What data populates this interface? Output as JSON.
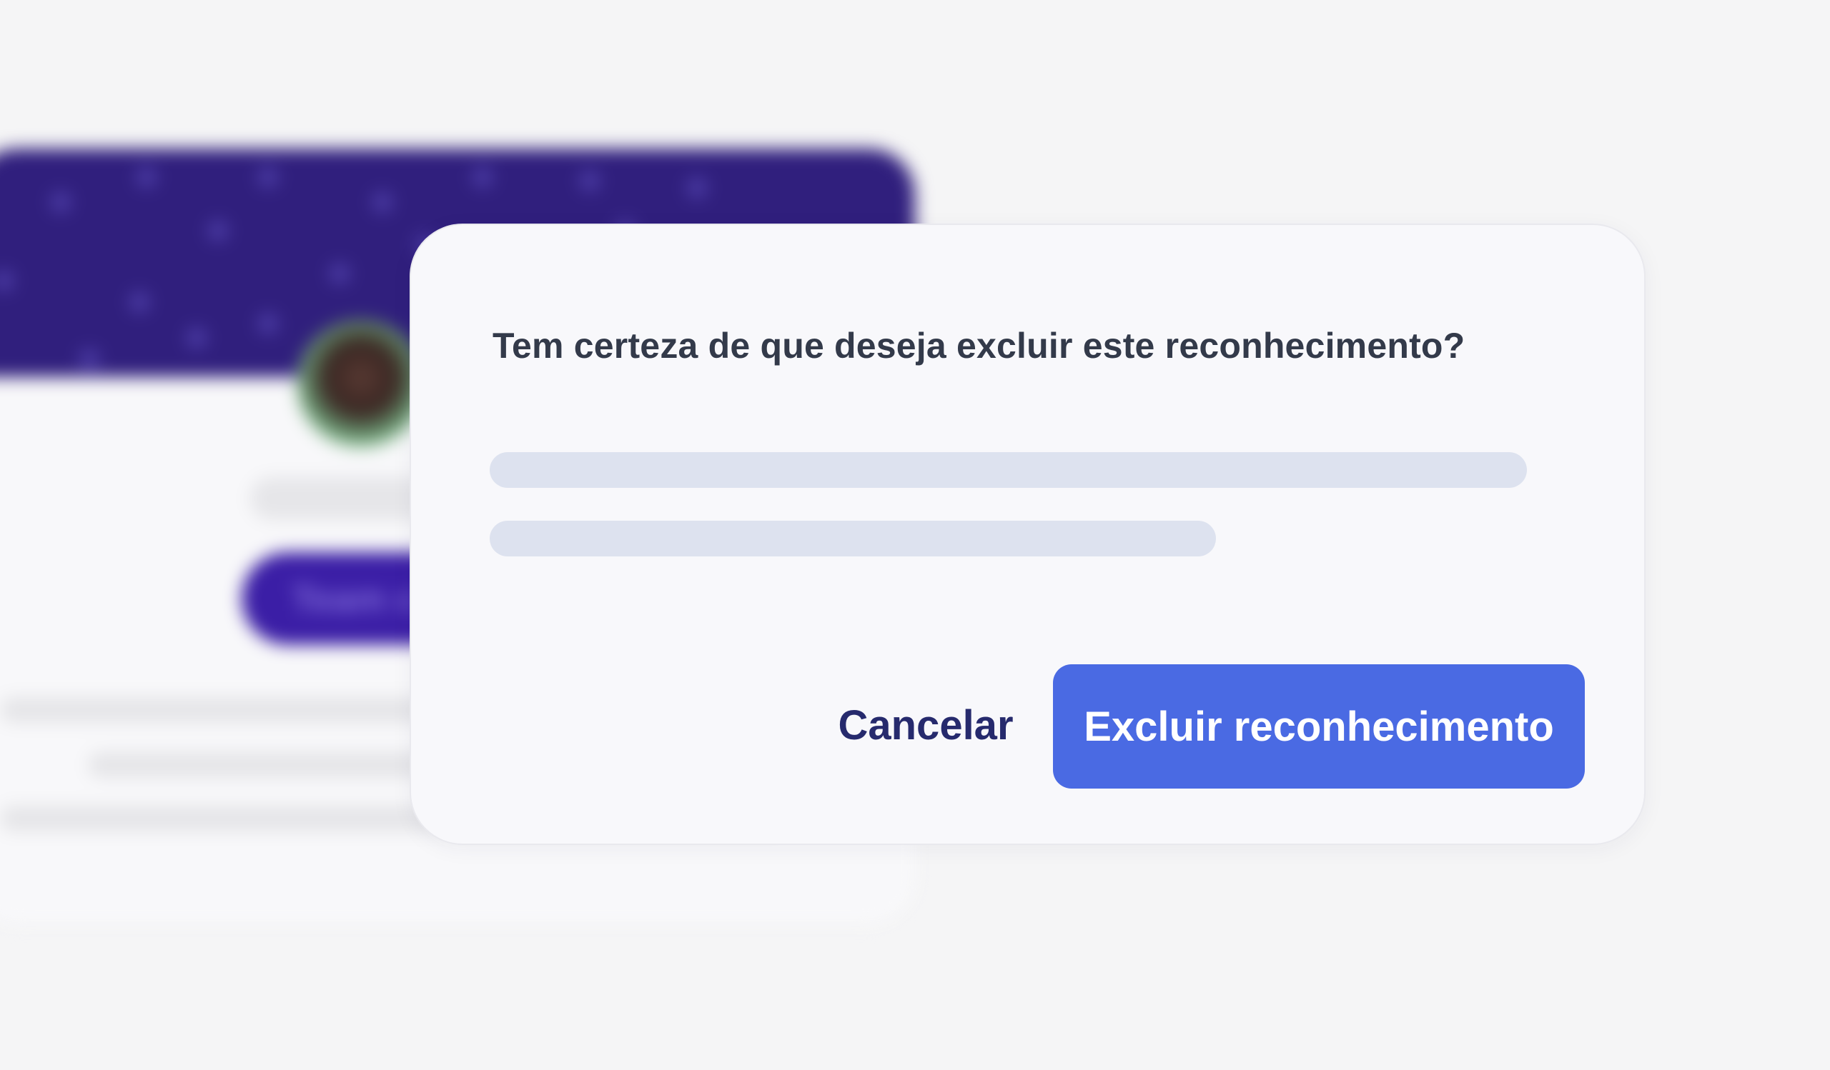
{
  "background_card": {
    "button_label": "Team c"
  },
  "dialog": {
    "title": "Tem certeza de que deseja excluir este reconhecimento?",
    "cancel_label": "Cancelar",
    "confirm_label": "Excluir reconhecimento"
  },
  "colors": {
    "page_background": "#f5f5f6",
    "banner": "#301f7d",
    "dialog_background": "#f8f8fb",
    "title_text": "#333a4a",
    "skeleton": "#dde2ef",
    "cancel_text": "#262a6d",
    "confirm_button": "#4a6ae3",
    "confirm_text": "#ffffff"
  }
}
